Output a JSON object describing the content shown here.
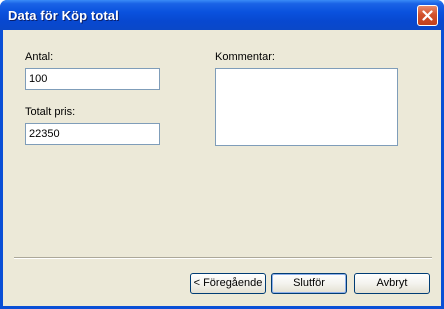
{
  "window": {
    "title": "Data för Köp total",
    "close_label": "×"
  },
  "form": {
    "quantity_label": "Antal:",
    "quantity_value": "100",
    "total_price_label": "Totalt pris:",
    "total_price_value": "22350",
    "comment_label": "Kommentar:",
    "comment_value": ""
  },
  "buttons": {
    "back_label": "< Föregående",
    "finish_label": "Slutför",
    "cancel_label": "Avbryt"
  },
  "colors": {
    "titlebar": "#0a52de",
    "dialog_background": "#ece9d8",
    "field_border": "#7f9db9",
    "close_button": "#d2512c"
  },
  "icons": {
    "close": "close-icon"
  }
}
